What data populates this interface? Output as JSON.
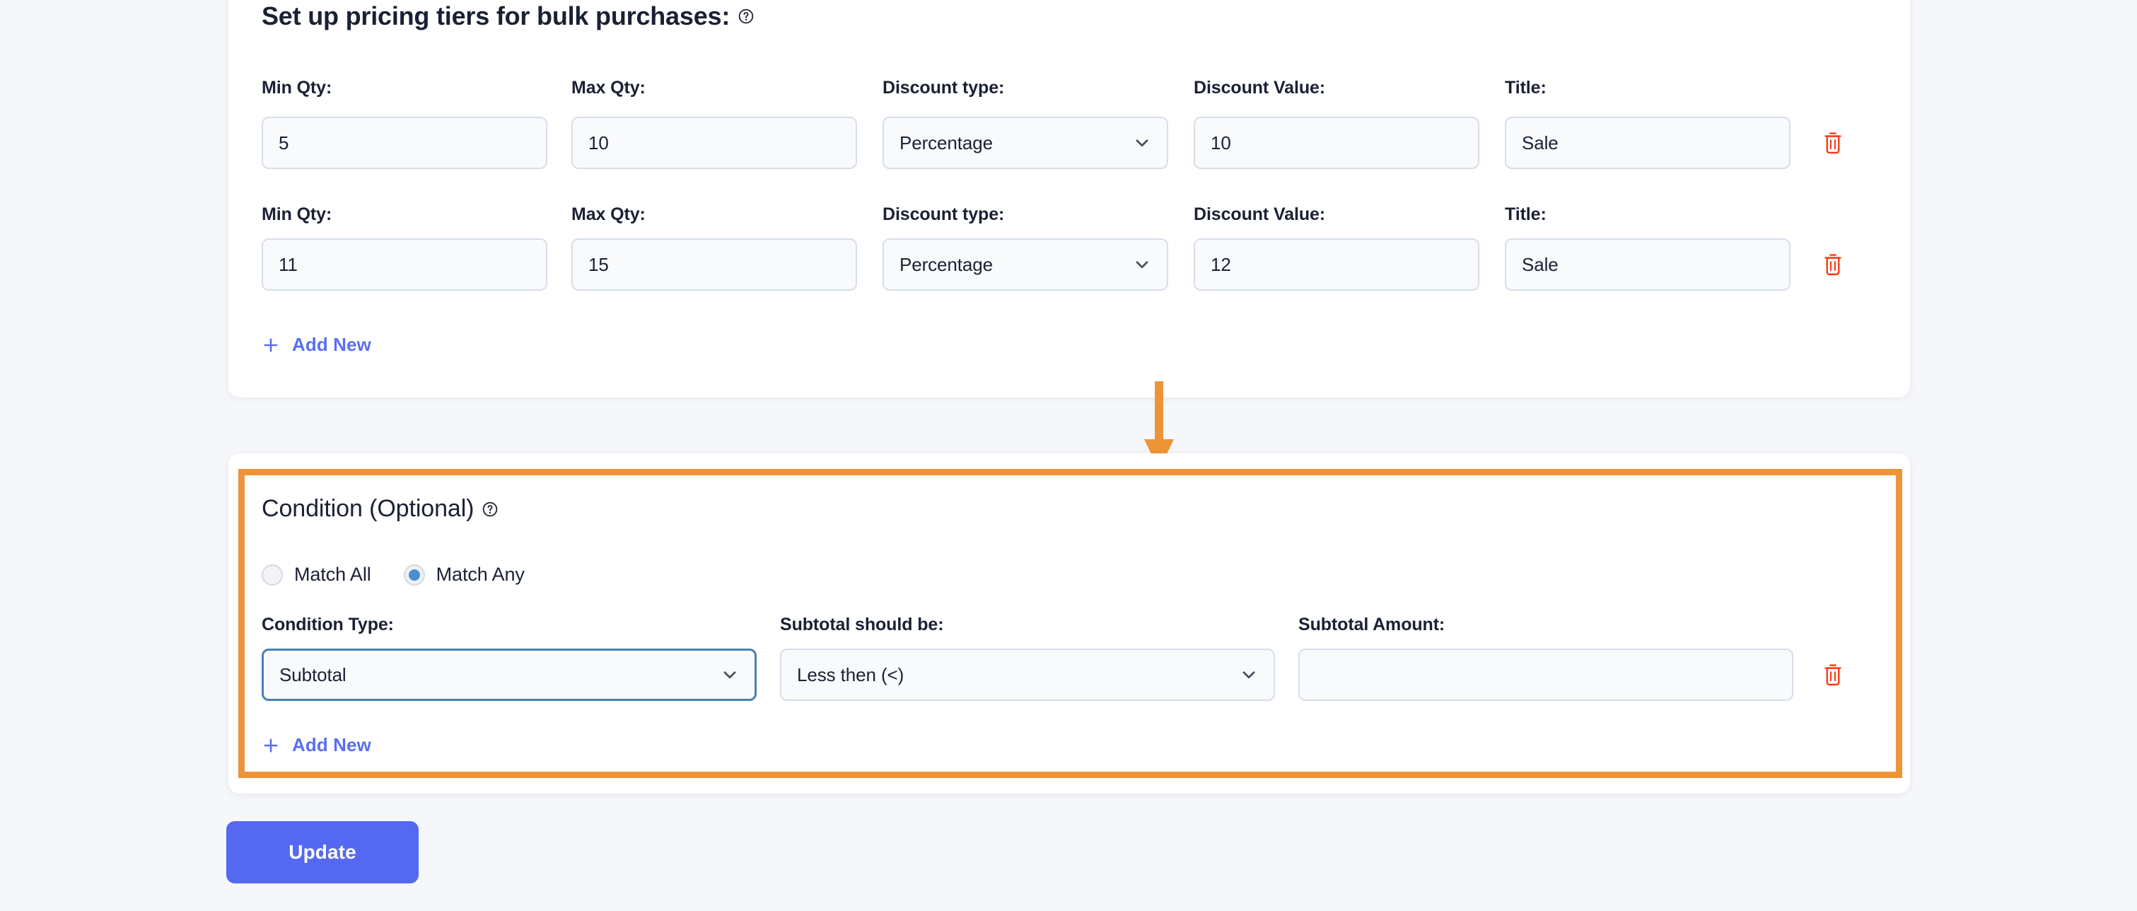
{
  "tiers_section": {
    "title_bold": "Set up pricing tiers for bulk purchases:",
    "help_icon": "help-circle-icon",
    "columns": {
      "min_qty": "Min Qty:",
      "max_qty": "Max Qty:",
      "discount_type": "Discount type:",
      "discount_value": "Discount Value:",
      "title": "Title:"
    },
    "rows": [
      {
        "min_qty": "5",
        "max_qty": "10",
        "discount_type": "Percentage",
        "discount_value": "10",
        "title": "Sale",
        "delete_icon": "trash-icon"
      },
      {
        "min_qty": "11",
        "max_qty": "15",
        "discount_type": "Percentage",
        "discount_value": "12",
        "title": "Sale",
        "delete_icon": "trash-icon"
      }
    ],
    "add_new_label": "Add New",
    "add_new_icon": "plus-icon"
  },
  "annotation": {
    "arrow_icon": "down-arrow-annotation",
    "arrow_color": "#ed9438",
    "highlight_color": "#ed9438"
  },
  "condition_section": {
    "title": "Condition (Optional)",
    "help_icon": "help-circle-icon",
    "match_mode": {
      "match_all_label": "Match All",
      "match_any_label": "Match Any",
      "selected": "Match Any"
    },
    "columns": {
      "condition_type": "Condition Type:",
      "comparator": "Subtotal should be:",
      "amount": "Subtotal Amount:"
    },
    "rows": [
      {
        "condition_type": "Subtotal",
        "comparator": "Less then (<)",
        "amount": "",
        "delete_icon": "trash-icon"
      }
    ],
    "add_new_label": "Add New",
    "add_new_icon": "plus-icon"
  },
  "footer": {
    "update_label": "Update"
  },
  "colors": {
    "page_background": "#f5f7fa",
    "card_background": "#ffffff",
    "accent_blue": "#5568f2",
    "link_blue": "#5a6ff0",
    "radio_blue": "#4a8fd1",
    "focus_border": "#4a7fb5",
    "trash_red": "#f93a13",
    "annotation_orange": "#ed9438",
    "input_background": "#f8fafc",
    "input_border": "#d8dee8",
    "text_primary": "#1b2134"
  }
}
